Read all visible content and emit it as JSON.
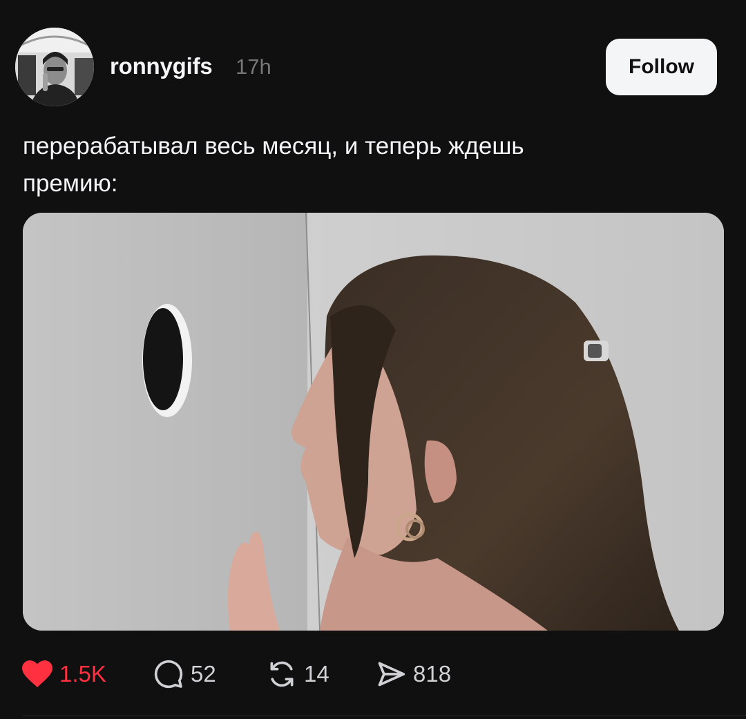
{
  "post": {
    "username": "ronnygifs",
    "time": "17h",
    "follow_label": "Follow",
    "caption": "перерабатывал весь месяц, и теперь ждешь\nпремию:"
  },
  "actions": {
    "likes": "1.5K",
    "replies": "52",
    "reposts": "14",
    "shares": "818"
  },
  "colors": {
    "background": "#101010",
    "text": "#f3f5f7",
    "muted": "#777777",
    "like": "#ff3040"
  }
}
